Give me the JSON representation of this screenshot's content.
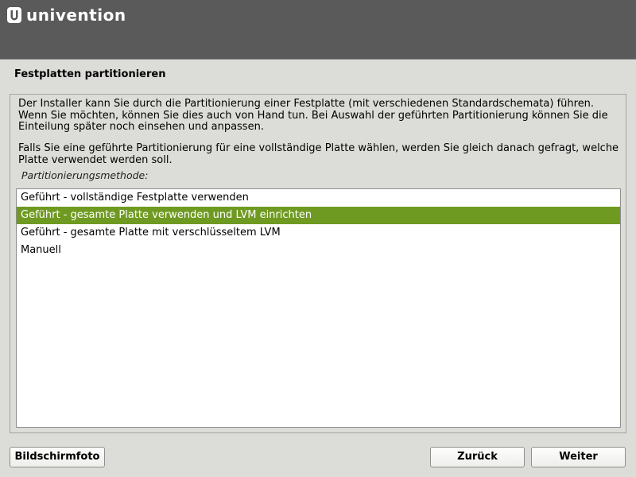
{
  "header": {
    "logo_text": "univention"
  },
  "page": {
    "title": "Festplatten partitionieren"
  },
  "content": {
    "paragraph1": "Der Installer kann Sie durch die Partitionierung einer Festplatte (mit verschiedenen Standardschemata) führen. Wenn Sie möchten, können Sie dies auch von Hand tun. Bei Auswahl der geführten Partitionierung können Sie die Einteilung später noch einsehen und anpassen.",
    "paragraph2": "Falls Sie eine geführte Partitionierung für eine vollständige Platte wählen, werden Sie gleich danach gefragt, welche Platte verwendet werden soll.",
    "method_label": "Partitionierungsmethode:",
    "options": [
      "Geführt - vollständige Festplatte verwenden",
      "Geführt - gesamte Platte verwenden und LVM einrichten",
      "Geführt - gesamte Platte mit verschlüsseltem LVM",
      "Manuell"
    ],
    "selected_index": 1
  },
  "buttons": {
    "screenshot": "Bildschirmfoto",
    "back": "Zurück",
    "next": "Weiter"
  },
  "colors": {
    "header_bg": "#5a5a5a",
    "selection": "#6f9a22"
  }
}
